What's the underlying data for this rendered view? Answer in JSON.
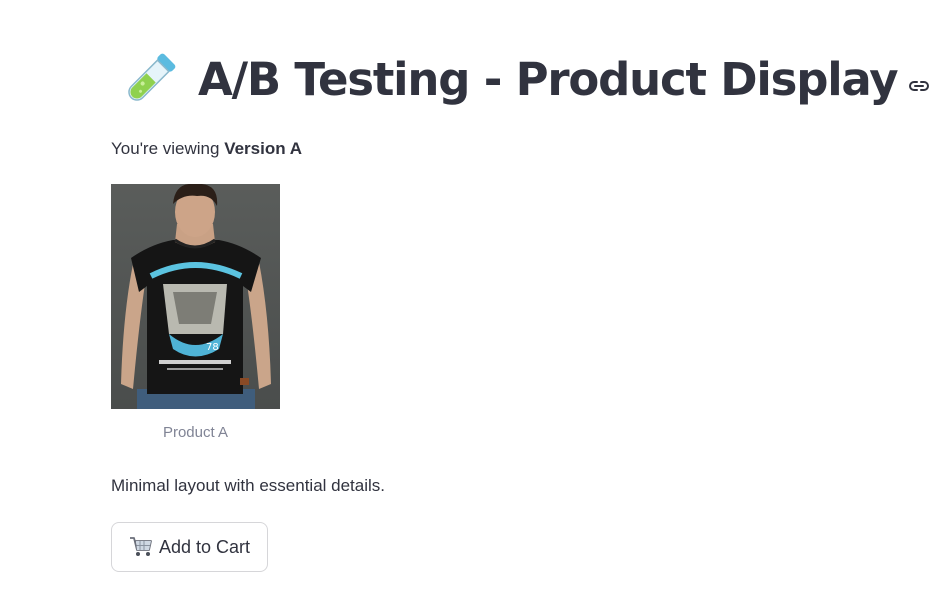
{
  "header": {
    "title": "A/B Testing - Product Display",
    "title_icon": "test-tube-icon",
    "anchor_icon": "link-icon"
  },
  "subtitle": {
    "prefix": "You're viewing ",
    "version": "Version A"
  },
  "product": {
    "image_icon": "product-photo",
    "caption": "Product A",
    "description": "Minimal layout with essential details."
  },
  "cart_button": {
    "icon": "shopping-cart-icon",
    "label": "Add to Cart"
  },
  "colors": {
    "text": "#31333f",
    "caption": "#808495",
    "border": "#d6d6d9",
    "tube_liquid": "#8fd14f",
    "tube_cap": "#5bbbe0"
  }
}
